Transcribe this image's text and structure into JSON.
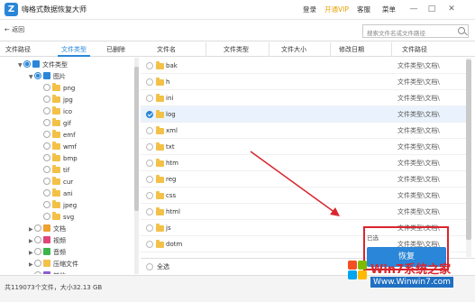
{
  "app": {
    "title": "嗨格式数据恢复大师",
    "logo_text": "Z",
    "menu": [
      "登录",
      "开通VIP",
      "客服",
      "菜单"
    ],
    "window_controls": [
      "—",
      "□",
      "✕"
    ]
  },
  "toolbar": {
    "back_label": "← 返回",
    "search_placeholder": "搜索文件名或文件路径"
  },
  "left_tabs": [
    "文件路径",
    "文件类型",
    "已删除"
  ],
  "active_left_tab": "文件类型",
  "tree": {
    "root_label": "文件类型",
    "pictures_label": "图片",
    "picture_types": [
      "png",
      "jpg",
      "ico",
      "gif",
      "emf",
      "wmf",
      "bmp",
      "tif",
      "cur",
      "ani",
      "jpeg",
      "svg"
    ],
    "other_nodes": [
      {
        "label": "文档",
        "color": "#f0a030"
      },
      {
        "label": "视频",
        "color": "#e0457b"
      },
      {
        "label": "音频",
        "color": "#3bb54a"
      },
      {
        "label": "压缩文件",
        "color": "#f3c148"
      },
      {
        "label": "其他",
        "color": "#8a5cd1"
      }
    ]
  },
  "columns": [
    "文件名",
    "文件类型",
    "文件大小",
    "修改日期",
    "文件路径"
  ],
  "files": [
    {
      "name": "bak",
      "path": "文件类型\\文档\\"
    },
    {
      "name": "h",
      "path": "文件类型\\文档\\"
    },
    {
      "name": "ini",
      "path": "文件类型\\文档\\"
    },
    {
      "name": "log",
      "path": "文件类型\\文档\\",
      "selected": true
    },
    {
      "name": "xml",
      "path": "文件类型\\文档\\"
    },
    {
      "name": "txt",
      "path": "文件类型\\文档\\"
    },
    {
      "name": "htm",
      "path": "文件类型\\文档\\"
    },
    {
      "name": "reg",
      "path": "文件类型\\文档\\"
    },
    {
      "name": "css",
      "path": "文件类型\\文档\\"
    },
    {
      "name": "html",
      "path": "文件类型\\文档\\"
    },
    {
      "name": "js",
      "path": "文件类型\\文档\\"
    },
    {
      "name": "dotm",
      "path": "文件类型\\文档\\"
    }
  ],
  "footer": {
    "select_all_label": "全选"
  },
  "status": {
    "summary": "共119073个文件，大小32.13 GB"
  },
  "action": {
    "small_label": "已选",
    "recover_label": "恢复"
  },
  "watermark": {
    "text": "Win7系统之家",
    "url": "Www.Winwin7.com"
  },
  "colors": {
    "accent": "#2a86d8",
    "folder": "#f3c148",
    "highlight_box": "#d9262e"
  }
}
